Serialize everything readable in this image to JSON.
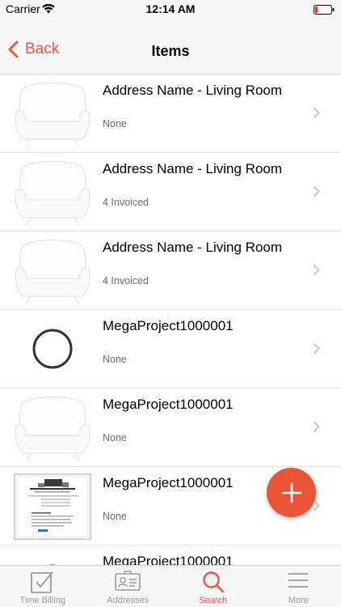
{
  "status_bar": {
    "carrier": "Carrier",
    "time": "12:14 AM"
  },
  "nav": {
    "back_label": "Back",
    "title": "Items"
  },
  "items": [
    {
      "name": "Address Name - Living Room",
      "status": "None",
      "thumb": "chair-icon"
    },
    {
      "name": "Address Name - Living Room",
      "status": "4 Invoiced",
      "thumb": "chair-icon"
    },
    {
      "name": "Address Name - Living Room",
      "status": "4 Invoiced",
      "thumb": "chair-icon"
    },
    {
      "name": "MegaProject1000001",
      "status": "None",
      "thumb": "circle-icon"
    },
    {
      "name": "MegaProject1000001",
      "status": "None",
      "thumb": "chair-icon"
    },
    {
      "name": "MegaProject1000001",
      "status": "None",
      "thumb": "document-thumbnail"
    },
    {
      "name": "MegaProject1000001",
      "status": "",
      "thumb": "circle-icon"
    }
  ],
  "tabs": [
    {
      "label": "Time Billing",
      "icon": "checkbox-icon",
      "active": false
    },
    {
      "label": "Addresses",
      "icon": "id-card-icon",
      "active": false
    },
    {
      "label": "Search",
      "icon": "search-icon",
      "active": true
    },
    {
      "label": "More",
      "icon": "menu-icon",
      "active": false
    }
  ],
  "colors": {
    "accent": "#e9573f",
    "fab": "#ea5535",
    "inactive_tab": "#9a9a9a"
  }
}
